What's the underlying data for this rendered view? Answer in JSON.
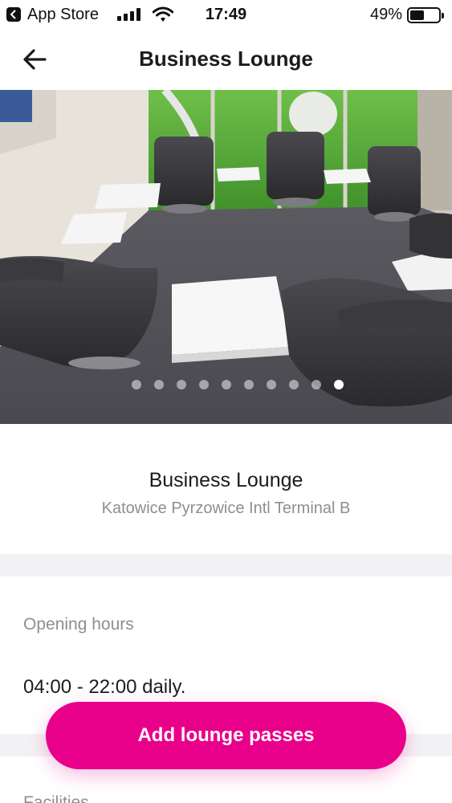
{
  "status_bar": {
    "back_app": "App Store",
    "time": "17:49",
    "battery_percent": "49%",
    "battery_level": 0.49
  },
  "nav": {
    "title": "Business Lounge",
    "back_icon": "arrow-left-icon"
  },
  "gallery": {
    "image_count": 10,
    "active_index": 9
  },
  "lounge": {
    "name": "Business Lounge",
    "location": "Katowice Pyrzowice Intl Terminal B"
  },
  "opening_hours": {
    "label": "Opening hours",
    "value": "04:00 - 22:00 daily."
  },
  "facilities": {
    "label": "Facilities"
  },
  "cta": {
    "label": "Add lounge passes",
    "color": "#e8008a"
  }
}
